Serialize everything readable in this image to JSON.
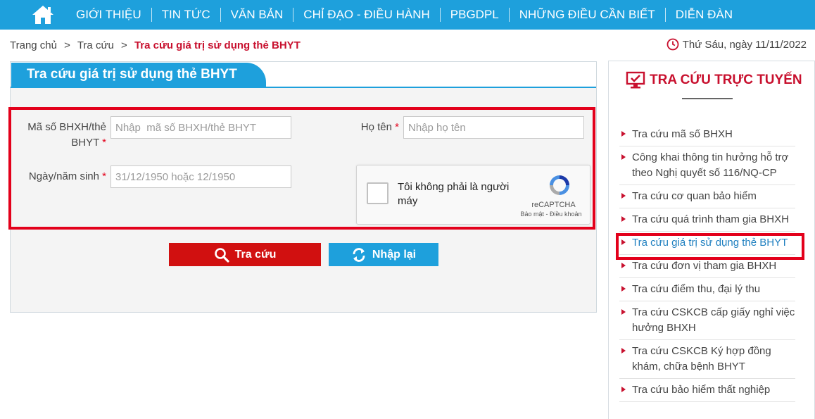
{
  "nav": {
    "items": [
      "GIỚI THIỆU",
      "TIN TỨC",
      "VĂN BẢN",
      "CHỈ ĐẠO - ĐIỀU HÀNH",
      "PBGDPL",
      "NHỮNG ĐIỀU CẦN BIẾT",
      "DIỄN ĐÀN"
    ]
  },
  "breadcrumb": {
    "items": [
      "Trang chủ",
      "Tra cứu",
      "Tra cứu giá trị sử dụng thẻ BHYT"
    ],
    "separator": ">"
  },
  "date": "Thứ Sáu, ngày 11/11/2022",
  "form": {
    "title": "Tra cứu giá trị sử dụng thẻ BHYT",
    "code_label_line1": "Mã số BHXH/thẻ",
    "code_label_line2": "BHYT",
    "code_placeholder": "Nhập  mã số BHXH/thẻ BHYT",
    "name_label": "Họ tên",
    "name_placeholder": "Nhập họ tên",
    "dob_label": "Ngày/năm sinh",
    "dob_placeholder": "31/12/1950 hoặc 12/1950",
    "required_mark": "*",
    "captcha": {
      "text": "Tôi không phải là người máy",
      "brand": "reCAPTCHA",
      "links": "Bảo mật - Điều khoản"
    },
    "search_button": "Tra cứu",
    "reset_button": "Nhập lại"
  },
  "sidebar": {
    "title": "TRA CỨU TRỰC TUYẾN",
    "items": [
      "Tra cứu mã số BHXH",
      "Công khai thông tin hưởng hỗ trợ theo Nghị quyết số 116/NQ-CP",
      "Tra cứu cơ quan bảo hiểm",
      "Tra cứu quá trình tham gia BHXH",
      "Tra cứu giá trị sử dụng thẻ BHYT",
      "Tra cứu đơn vị tham gia BHXH",
      "Tra cứu điểm thu, đại lý thu",
      "Tra cứu CSKCB cấp giấy nghỉ việc hưởng BHXH",
      "Tra cứu CSKCB Ký hợp đồng khám, chữa bệnh BHYT",
      "Tra cứu bảo hiểm thất nghiệp"
    ]
  },
  "colors": {
    "nav_blue": "#1ea0dc",
    "brand_red": "#c8102e",
    "highlight_red": "#e3001b",
    "search_button": "#d11010"
  },
  "icons": [
    "home-icon",
    "clock-icon",
    "search-icon",
    "refresh-icon",
    "monitor-check-icon",
    "recaptcha-logo-icon",
    "caret-right-icon"
  ]
}
